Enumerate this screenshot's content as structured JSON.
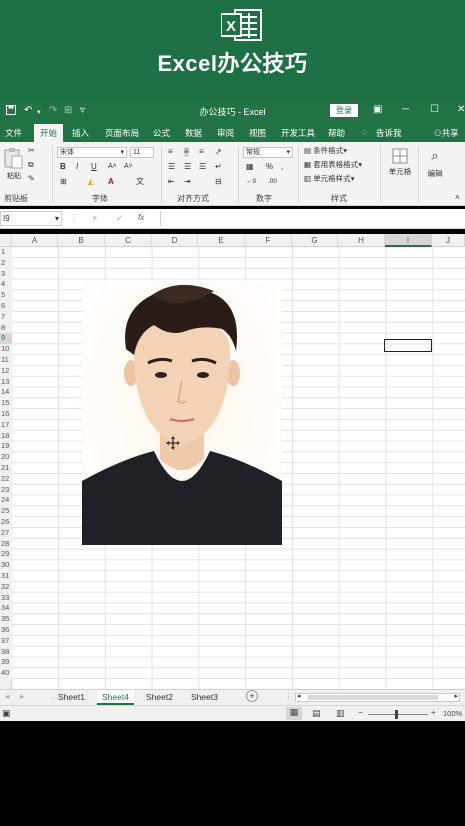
{
  "banner": {
    "title": "Excel办公技巧",
    "logo_letter": "X"
  },
  "titlebar": {
    "doc_title": "办公技巧  -  Excel",
    "login_label": "登录",
    "save_icon": "save-icon",
    "undo_icon": "undo-icon"
  },
  "tabs": {
    "file": "文件",
    "home": "开始",
    "insert": "插入",
    "page_layout": "页面布局",
    "formulas": "公式",
    "data": "数据",
    "review": "审阅",
    "view": "视图",
    "developer": "开发工具",
    "help": "帮助",
    "tell_me": "告诉我",
    "share": "共享"
  },
  "ribbon": {
    "paste_label": "粘贴",
    "clipboard_group": "剪贴板",
    "font_name": "宋体",
    "font_size": "11",
    "font_group": "字体",
    "alignment_group": "对齐方式",
    "number_format": "常规",
    "number_group": "数字",
    "conditional_format": "条件格式",
    "format_as_table": "套用表格格式",
    "cell_styles": "单元格样式",
    "styles_group": "样式",
    "cells_label": "单元格",
    "editing_label": "编辑",
    "bold": "B",
    "italic": "I",
    "underline": "U"
  },
  "formula_bar": {
    "name_box": "I9",
    "cancel": "×",
    "enter": "✓",
    "fx": "fx"
  },
  "grid": {
    "columns": [
      "A",
      "B",
      "C",
      "D",
      "E",
      "F",
      "G",
      "H",
      "I",
      "J"
    ],
    "rows": [
      "1",
      "2",
      "3",
      "4",
      "5",
      "6",
      "7",
      "8",
      "9",
      "10",
      "11",
      "12",
      "13",
      "14",
      "15",
      "16",
      "17",
      "18",
      "19",
      "20",
      "21",
      "22",
      "23",
      "24",
      "25",
      "26",
      "27",
      "28",
      "29",
      "30",
      "31",
      "32",
      "33",
      "34",
      "35",
      "36",
      "37",
      "38",
      "39",
      "40"
    ],
    "selected_column": "I",
    "selected_row": "9"
  },
  "sheets": {
    "tabs": [
      "Sheet1",
      "Sheet4",
      "Sheet2",
      "Sheet3"
    ],
    "active": "Sheet4",
    "add_label": "+"
  },
  "status": {
    "zoom": "100%"
  },
  "colors": {
    "excel_green": "#217346",
    "banner_green": "#1e7145"
  }
}
